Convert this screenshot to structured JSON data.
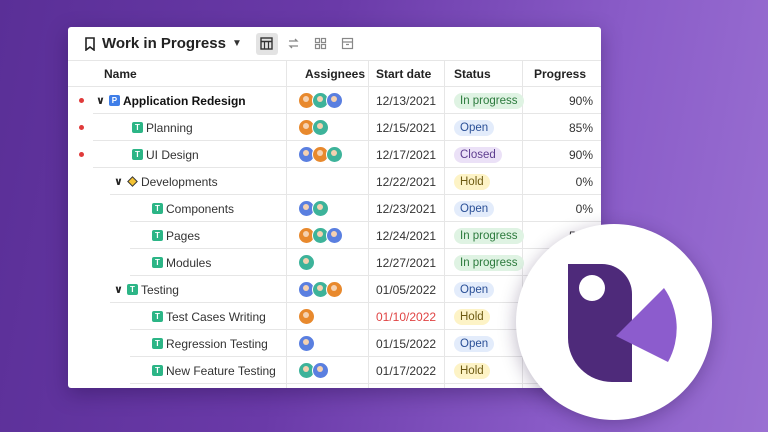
{
  "header": {
    "title": "Work in Progress",
    "views": [
      {
        "name": "table-view-icon",
        "active": true
      },
      {
        "name": "swap-view-icon",
        "active": false
      },
      {
        "name": "board-view-icon",
        "active": false
      },
      {
        "name": "archive-view-icon",
        "active": false
      }
    ]
  },
  "columns": {
    "name": "Name",
    "assignees": "Assignees",
    "start_date": "Start date",
    "status": "Status",
    "progress": "Progress"
  },
  "rows": [
    {
      "name": "Application Redesign",
      "tag": "P",
      "level": 0,
      "caret": true,
      "bold": true,
      "dot": true,
      "avatars": [
        "#e8892d",
        "#3db39a",
        "#5a7fe0"
      ],
      "start": "12/13/2021",
      "status": "In progress",
      "progress": "90%"
    },
    {
      "name": "Planning",
      "tag": "T",
      "level": 1,
      "caret": false,
      "bold": false,
      "dot": true,
      "avatars": [
        "#e8892d",
        "#3db39a"
      ],
      "start": "12/15/2021",
      "status": "Open",
      "progress": "85%"
    },
    {
      "name": "UI Design",
      "tag": "T",
      "level": 1,
      "caret": false,
      "bold": false,
      "dot": true,
      "avatars": [
        "#5a7fe0",
        "#e8892d",
        "#3db39a"
      ],
      "start": "12/17/2021",
      "status": "Closed",
      "progress": "90%"
    },
    {
      "name": "Developments",
      "tag": "D",
      "level": 1,
      "caret": true,
      "bold": false,
      "dot": false,
      "avatars": [],
      "start": "12/22/2021",
      "status": "Hold",
      "progress": "0%"
    },
    {
      "name": "Components",
      "tag": "T",
      "level": 2,
      "caret": false,
      "bold": false,
      "dot": false,
      "avatars": [
        "#5a7fe0",
        "#3db39a"
      ],
      "start": "12/23/2021",
      "status": "Open",
      "progress": "0%"
    },
    {
      "name": "Pages",
      "tag": "T",
      "level": 2,
      "caret": false,
      "bold": false,
      "dot": false,
      "avatars": [
        "#e8892d",
        "#3db39a",
        "#5a7fe0"
      ],
      "start": "12/24/2021",
      "status": "In progress",
      "progress": "50%"
    },
    {
      "name": "Modules",
      "tag": "T",
      "level": 2,
      "caret": false,
      "bold": false,
      "dot": false,
      "avatars": [
        "#3db39a"
      ],
      "start": "12/27/2021",
      "status": "In progress",
      "progress": ""
    },
    {
      "name": "Testing",
      "tag": "T",
      "level": 1,
      "caret": true,
      "bold": false,
      "dot": false,
      "avatars": [
        "#5a7fe0",
        "#3db39a",
        "#e8892d"
      ],
      "start": "01/05/2022",
      "status": "Open",
      "progress": ""
    },
    {
      "name": "Test Cases Writing",
      "tag": "T",
      "level": 2,
      "caret": false,
      "bold": false,
      "dot": false,
      "avatars": [
        "#e8892d"
      ],
      "start": "01/10/2022",
      "start_overdue": true,
      "status": "Hold",
      "progress": ""
    },
    {
      "name": "Regression Testing",
      "tag": "T",
      "level": 2,
      "caret": false,
      "bold": false,
      "dot": false,
      "avatars": [
        "#5a7fe0"
      ],
      "start": "01/15/2022",
      "status": "Open",
      "progress": ""
    },
    {
      "name": "New Feature Testing",
      "tag": "T",
      "level": 2,
      "caret": false,
      "bold": false,
      "dot": false,
      "avatars": [
        "#3db39a",
        "#5a7fe0"
      ],
      "start": "01/17/2022",
      "status": "Hold",
      "progress": ""
    }
  ],
  "status_colors": {
    "In progress": {
      "bg": "#dff3e3",
      "fg": "#2b7a3c"
    },
    "Open": {
      "bg": "#e3ecfb",
      "fg": "#2a4f96"
    },
    "Closed": {
      "bg": "#ebe1f7",
      "fg": "#5e3d8f"
    },
    "Hold": {
      "bg": "#fdf3c6",
      "fg": "#6d5a12"
    }
  },
  "colors": {
    "overdue_date": "#e04444",
    "logo_purple": "#4e2a7a",
    "logo_light_purple": "#8c5ccd"
  }
}
